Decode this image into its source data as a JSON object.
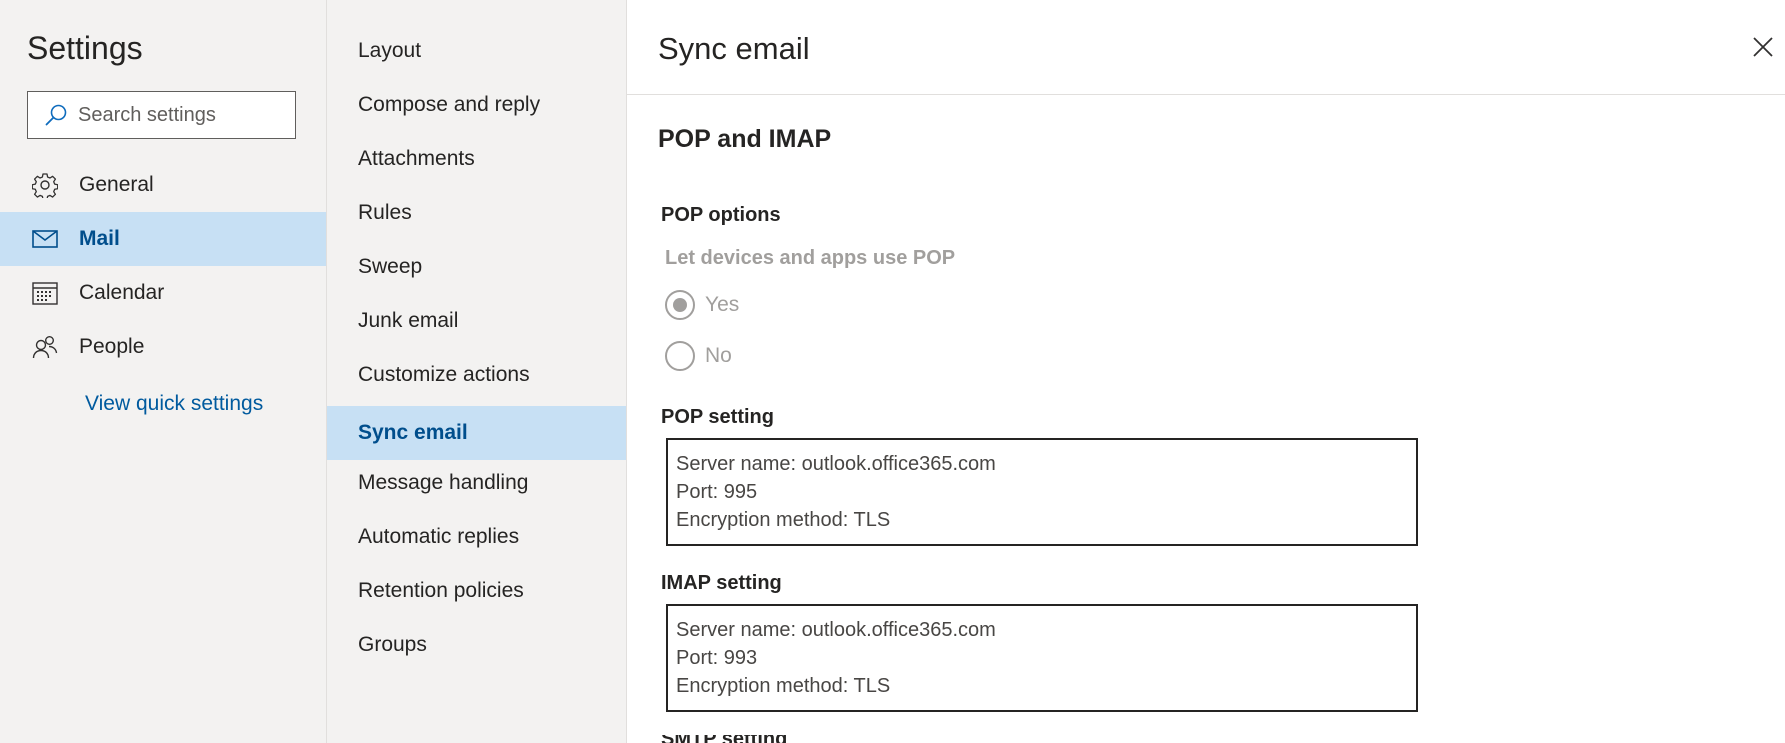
{
  "settings": {
    "title": "Settings",
    "search_placeholder": "Search settings"
  },
  "nav": {
    "items": [
      {
        "label": "General",
        "icon": "gear-icon"
      },
      {
        "label": "Mail",
        "icon": "mail-icon"
      },
      {
        "label": "Calendar",
        "icon": "calendar-icon"
      },
      {
        "label": "People",
        "icon": "people-icon"
      }
    ],
    "selected": "Mail",
    "quick_settings_link": "View quick settings"
  },
  "mail_sections": {
    "items": [
      "Layout",
      "Compose and reply",
      "Attachments",
      "Rules",
      "Sweep",
      "Junk email",
      "Customize actions",
      "Sync email",
      "Message handling",
      "Automatic replies",
      "Retention policies",
      "Groups"
    ],
    "selected": "Sync email"
  },
  "pane": {
    "title": "Sync email",
    "close_icon": "close-icon",
    "section_title": "POP and IMAP",
    "pop_options": {
      "title": "POP options",
      "question": "Let devices and apps use POP",
      "options": [
        "Yes",
        "No"
      ],
      "selected": "Yes"
    },
    "pop_setting": {
      "title": "POP setting",
      "lines": [
        "Server name: outlook.office365.com",
        "Port: 995",
        "Encryption method: TLS"
      ]
    },
    "imap_setting": {
      "title": "IMAP setting",
      "lines": [
        "Server name: outlook.office365.com",
        "Port: 993",
        "Encryption method: TLS"
      ]
    },
    "smtp_setting_title": "SMTP setting"
  },
  "colors": {
    "pane_bg": "#f3f2f1",
    "selected_bg": "#c7e0f4",
    "selected_text": "#004e8c",
    "link": "#005a9e",
    "disabled": "#a19f9d"
  }
}
